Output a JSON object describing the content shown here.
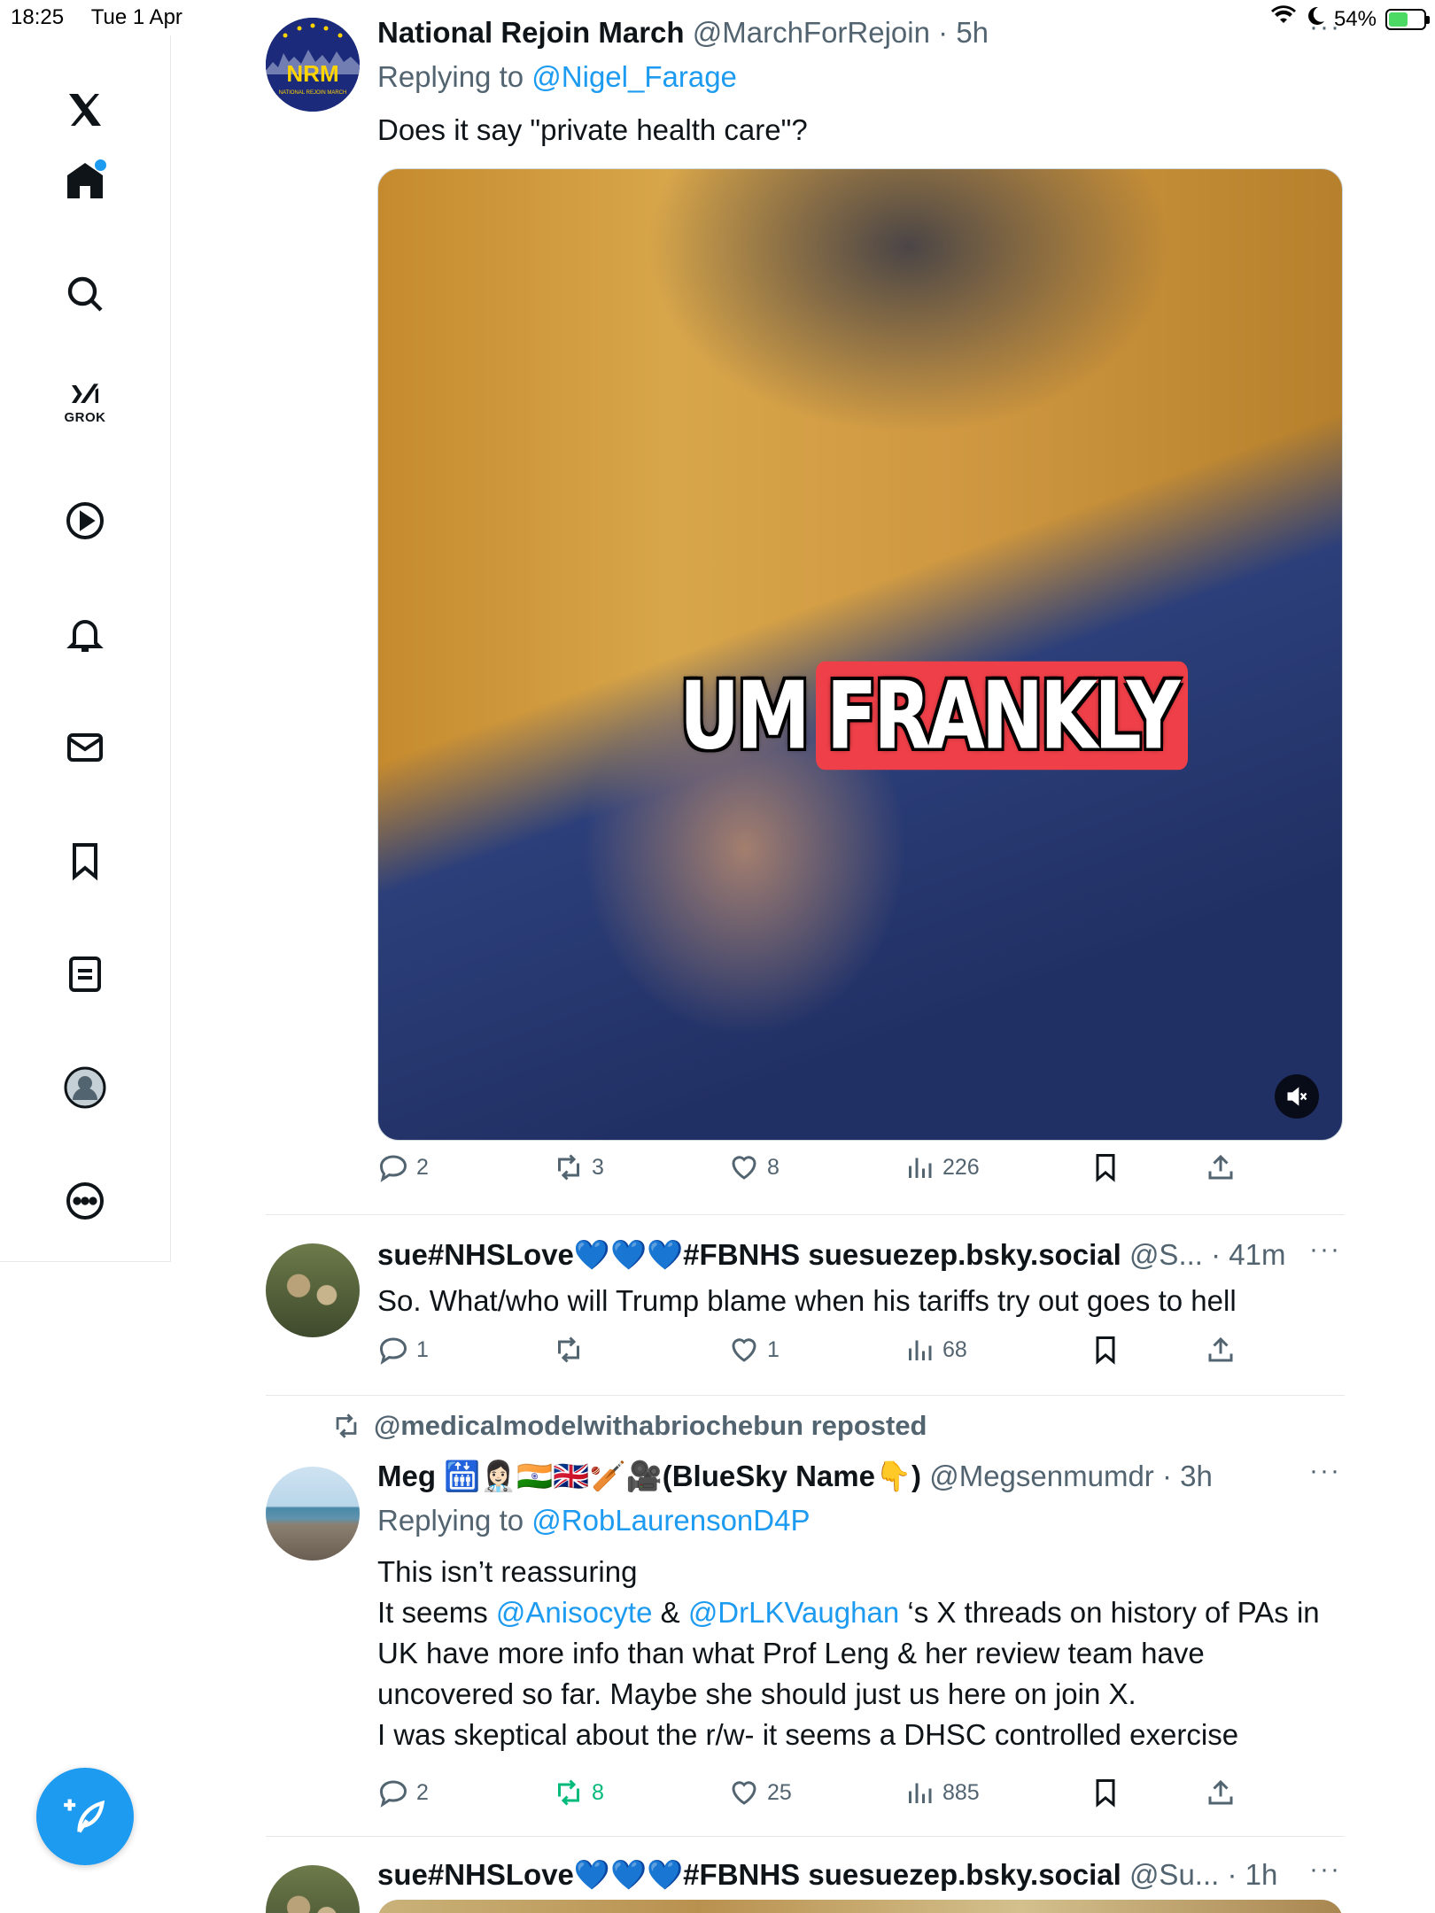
{
  "status_bar": {
    "time": "18:25",
    "date": "Tue 1 Apr",
    "battery": "54%",
    "battery_level": 0.54
  },
  "sidebar": {
    "items": [
      {
        "name": "x-logo-icon"
      },
      {
        "name": "home-icon",
        "has_notification_dot": true
      },
      {
        "name": "search-icon"
      },
      {
        "name": "grok-icon",
        "label": "GROK"
      },
      {
        "name": "video-icon"
      },
      {
        "name": "notifications-icon"
      },
      {
        "name": "messages-icon"
      },
      {
        "name": "bookmarks-icon"
      },
      {
        "name": "lists-icon"
      },
      {
        "name": "profile-icon"
      },
      {
        "name": "more-icon"
      }
    ],
    "compose_button": "compose-icon"
  },
  "colors": {
    "accent": "#1d9bf0",
    "muted": "#536471",
    "repost_active": "#00ba7c",
    "divider": "#e6e9ec"
  },
  "tweets": [
    {
      "name": "National Rejoin March",
      "handle": "@MarchForRejoin",
      "time": "5h",
      "replying_prefix": "Replying to",
      "replying_to": "@Nigel_Farage",
      "avatar_text": "NRM",
      "avatar_subtext": "NATIONAL REJOIN MARCH",
      "text": "Does it say \"private health care\"?",
      "video_caption_plain": "UM",
      "video_caption_highlight": "FRANKLY",
      "replies": "2",
      "reposts": "3",
      "likes": "8",
      "views": "226"
    },
    {
      "name": "sue#NHSLove💙💙💙#FBNHS suesuezep.bsky.social",
      "handle": "@S...",
      "time": "41m",
      "text": "So. What/who will Trump blame when his tariffs try out goes to hell",
      "replies": "1",
      "reposts": "",
      "likes": "1",
      "views": "68"
    },
    {
      "repost_by": "@medicalmodelwithabriochebun reposted",
      "name": "Meg 🛗👩🏻‍⚕️🇮🇳🇬🇧🏏🎥(BlueSky Name👇)",
      "handle": "@Megsenmumdr",
      "time": "3h",
      "replying_prefix": "Replying to",
      "replying_to": "@RobLaurensonD4P",
      "text_line1": "This isn’t reassuring",
      "text_seg1": "It seems ",
      "mention1": "@Anisocyte",
      "text_seg2": " & ",
      "mention2": "@DrLKVaughan",
      "text_seg3": " ‘s X threads on history of PAs in UK have more info than what Prof Leng & her review team have uncovered so far. Maybe she should just us here on join X.",
      "text_line_last": "I was skeptical about the r/w- it seems a DHSC controlled exercise",
      "replies": "2",
      "reposts": "8",
      "likes": "25",
      "views": "885"
    },
    {
      "name": "sue#NHSLove💙💙💙#FBNHS suesuezep.bsky.social",
      "handle": "@Su...",
      "time": "1h"
    }
  ],
  "separator": " · "
}
